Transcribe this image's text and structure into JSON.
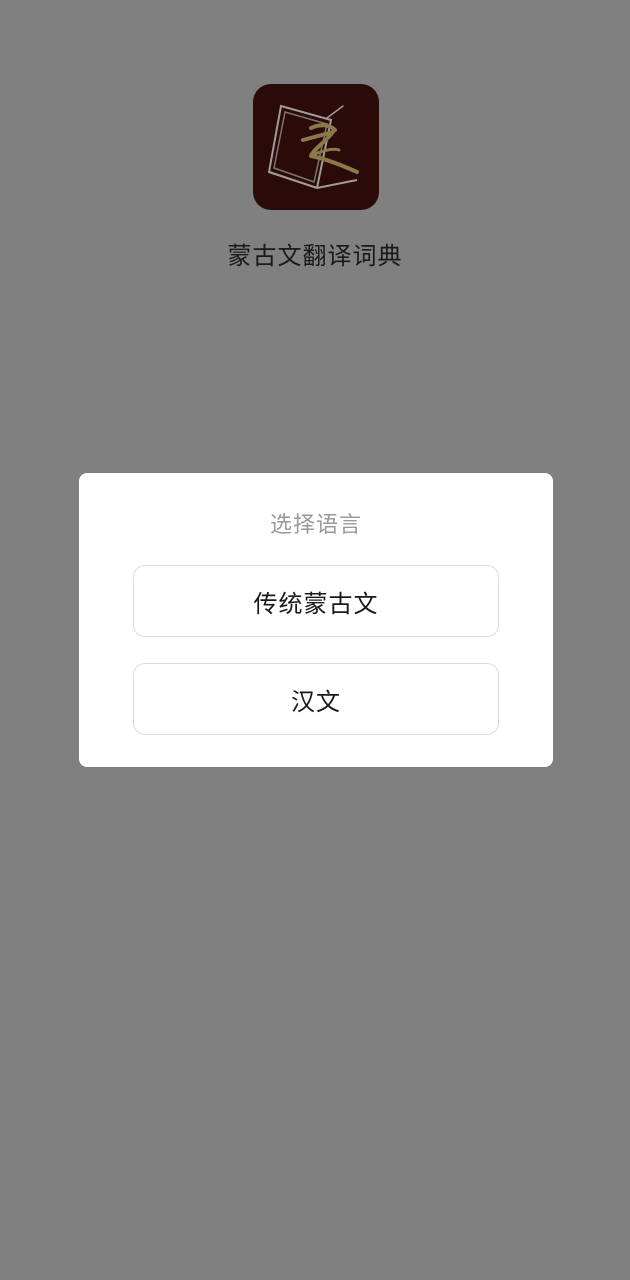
{
  "app": {
    "name": "蒙古文翻译词典",
    "icon": "mongolian-script-book-icon",
    "icon_bg": "#2a0b0a",
    "icon_accent": "#8a7a4a"
  },
  "backdrop_color": "#808080",
  "dialog": {
    "title": "选择语言",
    "options": [
      {
        "label": "传统蒙古文"
      },
      {
        "label": "汉文"
      }
    ]
  }
}
